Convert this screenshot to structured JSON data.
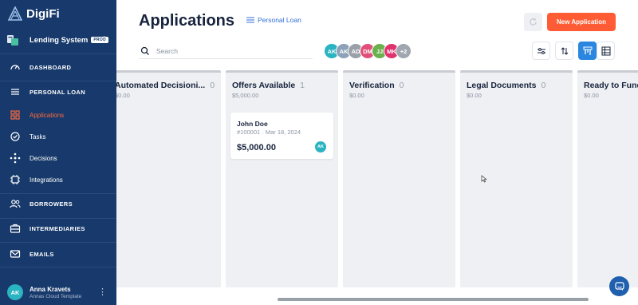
{
  "brand": {
    "name": "DigiFi"
  },
  "system": {
    "name": "Lending System",
    "badge": "PROD",
    "menu": "⋮"
  },
  "nav": {
    "dashboard": "DASHBOARD",
    "personal_loan": "PERSONAL LOAN",
    "applications": "Applications",
    "tasks": "Tasks",
    "decisions": "Decisions",
    "integrations": "Integrations",
    "borrowers": "BORROWERS",
    "intermediaries": "INTERMEDIARIES",
    "emails": "EMAILS"
  },
  "user": {
    "initials": "AK",
    "name": "Anna Kravets",
    "org": "Annas Cloud Template",
    "menu": "⋮"
  },
  "header": {
    "title": "Applications",
    "product": "Personal Loan",
    "new_button": "New Application"
  },
  "search": {
    "placeholder": "Search",
    "value": ""
  },
  "team": [
    {
      "initials": "AK",
      "color": "#2ab3c0"
    },
    {
      "initials": "AK",
      "color": "#8da2b8"
    },
    {
      "initials": "AD",
      "color": "#9aa0a8"
    },
    {
      "initials": "DM",
      "color": "#e0507a"
    },
    {
      "initials": "JJ",
      "color": "#6ab04c"
    },
    {
      "initials": "MK",
      "color": "#e0326e"
    },
    {
      "initials": "+2",
      "color": "#a0a6b0"
    }
  ],
  "columns": [
    {
      "title": "Automated Decisioni...",
      "count": "0",
      "sum": "$0.00"
    },
    {
      "title": "Offers Available",
      "count": "1",
      "sum": "$5,000.00"
    },
    {
      "title": "Verification",
      "count": "0",
      "sum": "$0.00"
    },
    {
      "title": "Legal Documents",
      "count": "0",
      "sum": "$0.00"
    },
    {
      "title": "Ready to Fund",
      "count": "",
      "sum": "$0.00"
    }
  ],
  "card": {
    "name": "John Doe",
    "meta": "#100001 · Mar 18, 2024",
    "amount": "$5,000.00",
    "assignee": "AK"
  },
  "colors": {
    "sidebar": "#17396b",
    "accent": "#ff5c35",
    "active_view": "#2b86e0"
  }
}
